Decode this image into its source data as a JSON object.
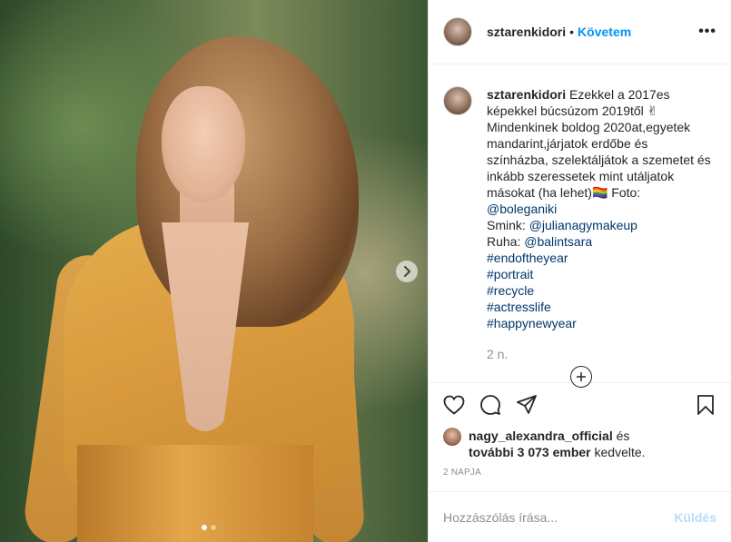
{
  "post": {
    "username": "sztarenkidori",
    "follow_label": "Követem",
    "dot": "•",
    "more_label": "•••"
  },
  "caption": {
    "username": "sztarenkidori",
    "lines": [
      "Ezekkel a 2017es",
      "képekkel búcsúzom 2019től ✌",
      "Mindenkinek boldog 2020at,egyetek",
      "mandarint,járjatok erdőbe és",
      "színházba, szelektáljátok a szemetet és",
      "inkább szeressetek mint utáljatok",
      "másokat (ha lehet)🏳️‍🌈 Foto:"
    ],
    "photo_credit": "@boleganiki",
    "makeup_prefix": "Smink: ",
    "makeup_credit": "@julianagymakeup",
    "outfit_prefix": "Ruha: ",
    "outfit_credit": "@balintsara",
    "hashtags": [
      "#endoftheyear",
      "#portrait",
      "#recycle",
      "#actresslife",
      "#happynewyear"
    ],
    "time": "2 n."
  },
  "likes": {
    "user": "nagy_alexandra_official",
    "suffix": " és",
    "others": "további 3 073 ember",
    "liked": " kedvelte."
  },
  "timestamp": "2 napja",
  "comment_box": {
    "placeholder": "Hozzászólás írása...",
    "post_label": "Küldés"
  },
  "icons": {
    "like": "heart-icon",
    "comment": "comment-icon",
    "share": "share-icon",
    "save": "bookmark-icon",
    "next": "chevron-right-icon",
    "load_more": "plus-circle-icon"
  },
  "carousel": {
    "total": 2,
    "active": 1
  },
  "colors": {
    "link": "#00376b",
    "accent": "#0095f6",
    "muted": "#8e8e8e"
  }
}
